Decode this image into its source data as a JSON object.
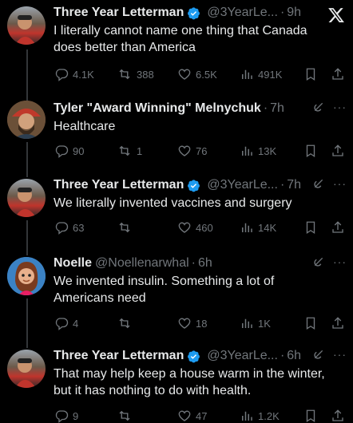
{
  "tweets": [
    {
      "name": "Three Year Letterman",
      "handle": "@3YearLe...",
      "time": "9h",
      "verified": true,
      "text": [
        "I literally cannot name one thing that Canada",
        "does better than America"
      ],
      "replies": "4.1K",
      "retweets": "388",
      "likes": "6.5K",
      "views": "491K"
    },
    {
      "name": "Tyler \"Award Winning\" Melnychuk",
      "handle": "",
      "time": "7h",
      "verified": false,
      "text": [
        "Healthcare"
      ],
      "replies": "90",
      "retweets": "1",
      "likes": "76",
      "views": "13K"
    },
    {
      "name": "Three Year Letterman",
      "handle": "@3YearLe...",
      "time": "7h",
      "verified": true,
      "text": [
        "We literally invented vaccines and surgery"
      ],
      "replies": "63",
      "retweets": "",
      "likes": "460",
      "views": "14K"
    },
    {
      "name": "Noelle",
      "handle": "@Noellenarwhal",
      "time": "6h",
      "verified": false,
      "text": [
        "We invented insulin. Something a lot of",
        "Americans need"
      ],
      "replies": "4",
      "retweets": "",
      "likes": "18",
      "views": "1K"
    },
    {
      "name": "Three Year Letterman",
      "handle": "@3YearLe...",
      "time": "6h",
      "verified": true,
      "text": [
        "That may help keep a house warm in the winter,",
        "but it has nothing to do with health."
      ],
      "replies": "9",
      "retweets": "",
      "likes": "47",
      "views": "1.2K"
    }
  ],
  "colors": {
    "background": "#000000",
    "text": "#e7e9ea",
    "muted": "#71767b",
    "verified": "#1d9bf0"
  },
  "icons": [
    "x-logo-icon",
    "reply-icon",
    "retweet-icon",
    "like-icon",
    "views-icon",
    "bookmark-icon",
    "share-icon",
    "grok-icon",
    "more-icon",
    "verified-icon"
  ]
}
